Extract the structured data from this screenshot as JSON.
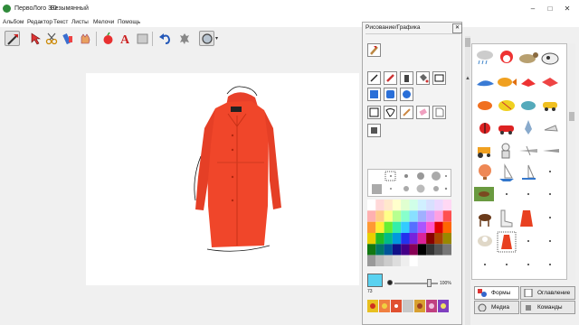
{
  "window": {
    "app_title": "ПервоЛого 3.0",
    "doc_title": "Безымянный",
    "controls": [
      "–",
      "□",
      "✕"
    ]
  },
  "menu": [
    "Альбом",
    "Редактор",
    "Текст",
    "Листы",
    "Мелочи",
    "Помощь"
  ],
  "toolbar": {
    "icons": [
      "flag-pencil",
      "cursor-arrow",
      "scissors",
      "glue",
      "hand-stamp",
      "apple",
      "text-A",
      "frame",
      "undo",
      "turtle",
      "shape-circle"
    ]
  },
  "draw_panel": {
    "title": "Рисование/Графика",
    "close": "✕",
    "opacity": "100%",
    "current_color": "#5ad2f0",
    "current_color_num": "73",
    "palette_colors": [
      "#ffffff",
      "#ffd8d8",
      "#ffe8cc",
      "#ffffcc",
      "#e0ffd0",
      "#d0ffe8",
      "#d0f0ff",
      "#d8e0ff",
      "#ecd8ff",
      "#ffd8f4",
      "#ffb0b0",
      "#ffcc88",
      "#ffff88",
      "#b8ff90",
      "#88ffcc",
      "#88e0ff",
      "#a0b0ff",
      "#d0a0ff",
      "#ffa0e0",
      "#ff5050",
      "#ff9933",
      "#ffee33",
      "#66ee33",
      "#33eeaa",
      "#33ccff",
      "#5570ff",
      "#aa55ff",
      "#ff55cc",
      "#e00000",
      "#ff6600",
      "#e8d000",
      "#22bb22",
      "#00bb88",
      "#0099dd",
      "#2233ee",
      "#7722dd",
      "#dd2299",
      "#880000",
      "#aa4400",
      "#998800",
      "#117711",
      "#007766",
      "#005599",
      "#111188",
      "#440088",
      "#880055",
      "#000000",
      "#333333",
      "#555555",
      "#777777",
      "#999999",
      "#bbbbbb",
      "#cccccc",
      "#dddddd",
      "#eeeeee",
      "#ffffff"
    ]
  },
  "tabs": {
    "shapes": "Формы",
    "contents": "Оглавление",
    "media": "Медиа",
    "commands": "Команды"
  },
  "accent": {
    "coat": "#f0462a",
    "coat_dark": "#c83218"
  }
}
